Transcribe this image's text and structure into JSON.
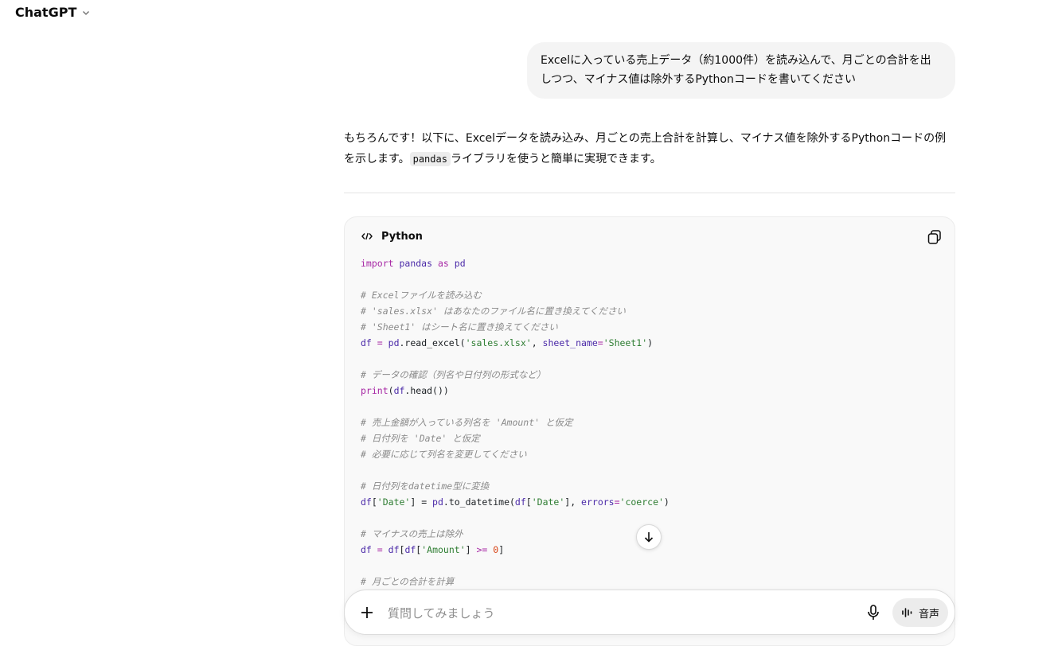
{
  "header": {
    "title": "ChatGPT"
  },
  "conversation": {
    "user_message": "Excelに入っている売上データ（約1000件）を読み込んで、月ごとの合計を出しつつ、マイナス値は除外するPythonコードを書いてください",
    "assistant_intro_1": "もちろんです！以下に、Excelデータを読み込み、月ごとの売上合計を計算し、マイナス値を除外するPythonコードの例を示します。",
    "assistant_inline_code": "pandas",
    "assistant_intro_2": "ライブラリを使うと簡単に実現できます。"
  },
  "code_block": {
    "language": "Python",
    "lines": {
      "l1_kw": "import",
      "l1_mod": "pandas",
      "l1_as": "as",
      "l1_alias": "pd",
      "c1": "# Excelファイルを読み込む",
      "c2": "# 'sales.xlsx' はあなたのファイル名に置き換えてください",
      "c3": "# 'Sheet1' はシート名に置き換えてください",
      "l5_a": "df",
      "l5_b": " = ",
      "l5_c": "pd",
      "l5_d": ".read_excel(",
      "l5_e": "'sales.xlsx'",
      "l5_f": ", ",
      "l5_g": "sheet_name",
      "l5_h": "=",
      "l5_i": "'Sheet1'",
      "l5_j": ")",
      "c4": "# データの確認（列名や日付列の形式など）",
      "l7_a": "print",
      "l7_b": "(",
      "l7_c": "df",
      "l7_d": ".head())",
      "c5": "# 売上金額が入っている列名を 'Amount' と仮定",
      "c6": "# 日付列を 'Date' と仮定",
      "c7": "# 必要に応じて列名を変更してください",
      "c8": "# 日付列をdatetime型に変換",
      "l12_a": "df",
      "l12_b": "[",
      "l12_c": "'Date'",
      "l12_d": "] = ",
      "l12_e": "pd",
      "l12_f": ".to_datetime(",
      "l12_g": "df",
      "l12_h": "[",
      "l12_i": "'Date'",
      "l12_j": "], ",
      "l12_k": "errors",
      "l12_l": "=",
      "l12_m": "'coerce'",
      "l12_n": ")",
      "c9": "# マイナスの売上は除外",
      "l14_a": "df",
      "l14_b": " = ",
      "l14_c": "df",
      "l14_d": "[",
      "l14_e": "df",
      "l14_f": "[",
      "l14_g": "'Amount'",
      "l14_h": "] ",
      "l14_i": ">=",
      "l14_j": " ",
      "l14_k": "0",
      "l14_l": "]",
      "c10": "# 月ごとの合計を計算"
    }
  },
  "composer": {
    "placeholder": "質問してみましょう",
    "voice_label": "音声"
  },
  "icons": {
    "header_chevron": "chevron-down-icon",
    "code_lang": "code-icon",
    "copy": "copy-icon",
    "scroll": "arrow-down-icon",
    "attach": "plus-icon",
    "mic": "microphone-icon",
    "voice": "voice-wave-icon"
  }
}
